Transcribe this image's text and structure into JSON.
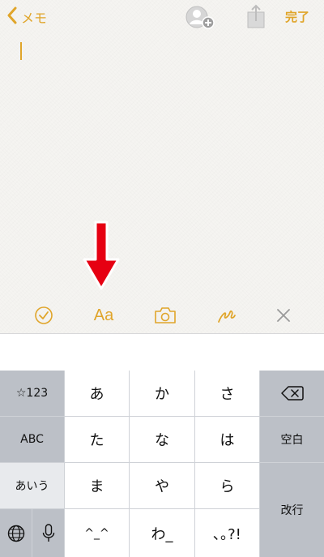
{
  "nav": {
    "back_label": "メモ",
    "done_label": "完了"
  },
  "toolbar": {
    "text_format_label": "Aa"
  },
  "keyboard": {
    "left_keys": [
      "☆123",
      "ABC",
      "あいう"
    ],
    "center_keys": [
      [
        "あ",
        "か",
        "さ"
      ],
      [
        "た",
        "な",
        "は"
      ],
      [
        "ま",
        "や",
        "ら"
      ],
      [
        "^_^",
        "わ_",
        "､｡?!"
      ]
    ],
    "space_label": "空白",
    "return_label": "改行"
  },
  "colors": {
    "accent": "#e0a52a",
    "annotation_arrow": "#e60012",
    "toolbar_close": "#9a9a9a"
  },
  "icons": [
    "chevron-left-icon",
    "add-person-icon",
    "share-icon",
    "checklist-icon",
    "camera-icon",
    "sketch-icon",
    "close-icon",
    "arrow-down-icon",
    "backspace-icon",
    "globe-icon",
    "microphone-icon"
  ]
}
